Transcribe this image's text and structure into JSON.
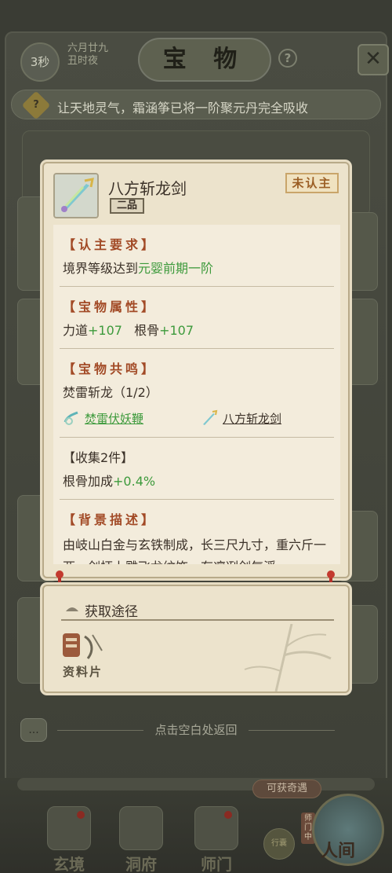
{
  "header": {
    "timer": "3秒",
    "date_line1": "六月廿九",
    "date_line2": "丑时夜",
    "title": "宝 物",
    "help": "?",
    "close": "✕"
  },
  "notice": {
    "icon_text": "?",
    "text": "让天地灵气，霜涵筝已将一阶聚元丹完全吸收"
  },
  "item": {
    "name": "八方斩龙剑",
    "grade": "二品",
    "bind_status": "未认主",
    "sections": {
      "requirement": {
        "title": "【认主要求】",
        "prefix": "境界等级达到",
        "value": "元婴前期一阶"
      },
      "attributes": {
        "title": "【宝物属性】",
        "stat1_label": "力道",
        "stat1_value": "+107",
        "stat2_label": "根骨",
        "stat2_value": "+107"
      },
      "resonance": {
        "title": "【宝物共鸣】",
        "set_name": "焚雷斩龙（1/2）",
        "piece1": "焚雷伏妖鞭",
        "piece2": "八方斩龙剑"
      },
      "collection": {
        "title": "【收集2件】",
        "bonus_label": "根骨加成",
        "bonus_value": "+0.4%"
      },
      "background": {
        "title": "【背景描述】",
        "text": "由岐山白金与玄铁制成，长三尺九寸，重六斤一两，剑柄上雕飞龙纹饰，有凛冽剑气浮"
      }
    }
  },
  "source": {
    "title": "获取途径",
    "item_label": "资料片"
  },
  "back_hint": "点击空白处返回",
  "chat_icon": "...",
  "bottom": {
    "obtain_label": "可获奇遇",
    "nav": [
      "玄境",
      "洞府",
      "师门"
    ],
    "small_item": "行囊",
    "master_tag": "师门中",
    "world": "人间"
  },
  "colors": {
    "accent_red": "#a24a26",
    "bonus_green": "#3d9a3c",
    "parchment": "#ece3cc"
  },
  "icons": [
    "timer-icon",
    "help-icon",
    "close-icon",
    "notice-icon",
    "sword-icon",
    "whip-icon",
    "source-icon",
    "chat-icon"
  ]
}
